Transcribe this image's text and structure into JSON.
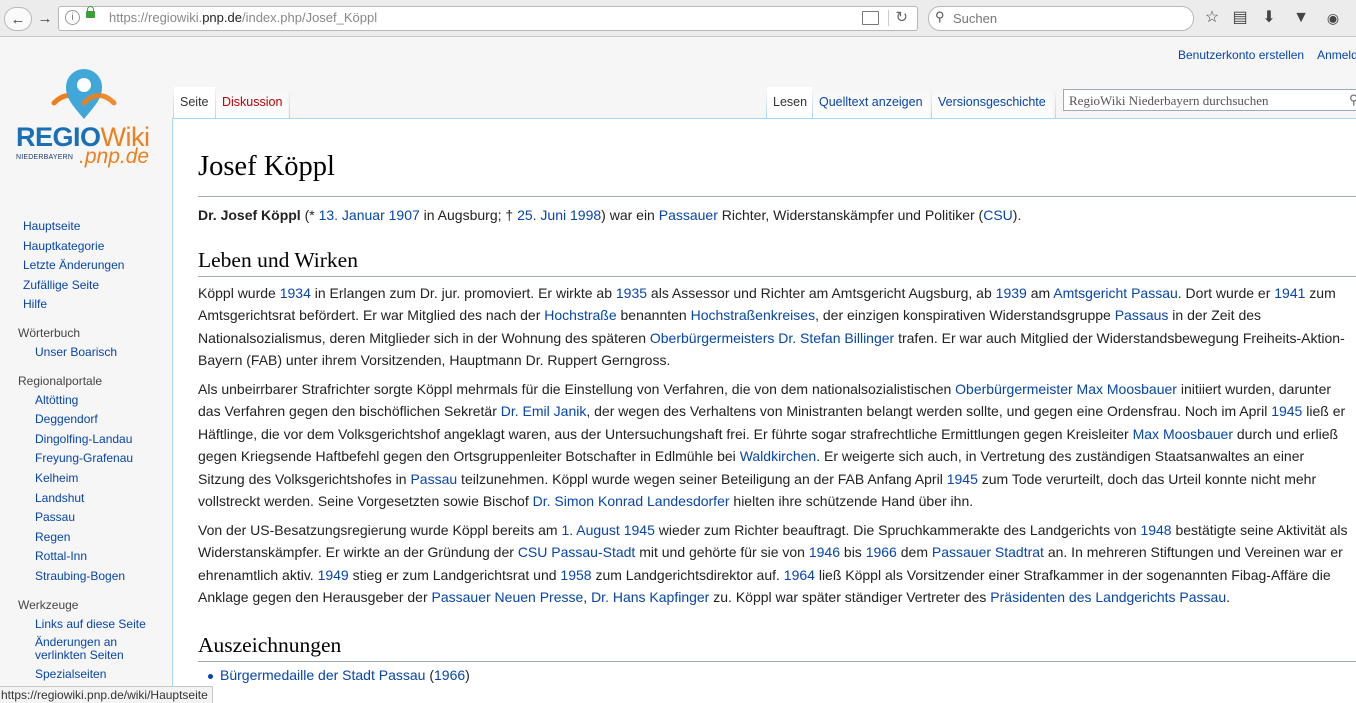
{
  "browser": {
    "url_prefix": "https://regiowiki.",
    "url_domain": "pnp.de",
    "url_path": "/index.php/Josef_Köppl",
    "search_placeholder": "Suchen",
    "status_url": "https://regiowiki.pnp.de/wiki/Hauptseite"
  },
  "personal": {
    "create_account": "Benutzerkonto erstellen",
    "login": "Anmelden"
  },
  "logo": {
    "regio": "REGIO",
    "wiki": "Wiki",
    "region": "NIEDERBAYERN",
    "domain": ".pnp.de"
  },
  "sidebar": {
    "nav": [
      "Hauptseite",
      "Hauptkategorie",
      "Letzte Änderungen",
      "Zufällige Seite",
      "Hilfe"
    ],
    "woerterbuch": {
      "title": "Wörterbuch",
      "items": [
        "Unser Boarisch"
      ]
    },
    "regionalportale": {
      "title": "Regionalportale",
      "items": [
        "Altötting",
        "Deggendorf",
        "Dingolfing-Landau",
        "Freyung-Grafenau",
        "Kelheim",
        "Landshut",
        "Passau",
        "Regen",
        "Rottal-Inn",
        "Straubing-Bogen"
      ]
    },
    "werkzeuge": {
      "title": "Werkzeuge",
      "items": [
        "Links auf diese Seite",
        "Änderungen an verlinkten Seiten",
        "Spezialseiten"
      ]
    }
  },
  "tabs": {
    "page": "Seite",
    "discussion": "Diskussion",
    "read": "Lesen",
    "view_source": "Quelltext anzeigen",
    "history": "Versionsgeschichte",
    "search_placeholder": "RegioWiki Niederbayern durchsuchen"
  },
  "article": {
    "title": "Josef Köppl",
    "intro": {
      "name": "Dr. Josef Köppl",
      "t1": " (* ",
      "birth": "13. Januar 1907",
      "t2": " in Augsburg; † ",
      "death": "25. Juni 1998",
      "t3": ") war ein ",
      "passauer": "Passauer",
      "t4": " Richter, Widerstanskämpfer und Politiker (",
      "csu": "CSU",
      "t5": ")."
    },
    "section1": "Leben und Wirken",
    "section2": "Auszeichnungen",
    "award": {
      "medal": "Bürgermedaille der Stadt Passau",
      "open": " (",
      "year": "1966",
      "close": ")"
    }
  }
}
